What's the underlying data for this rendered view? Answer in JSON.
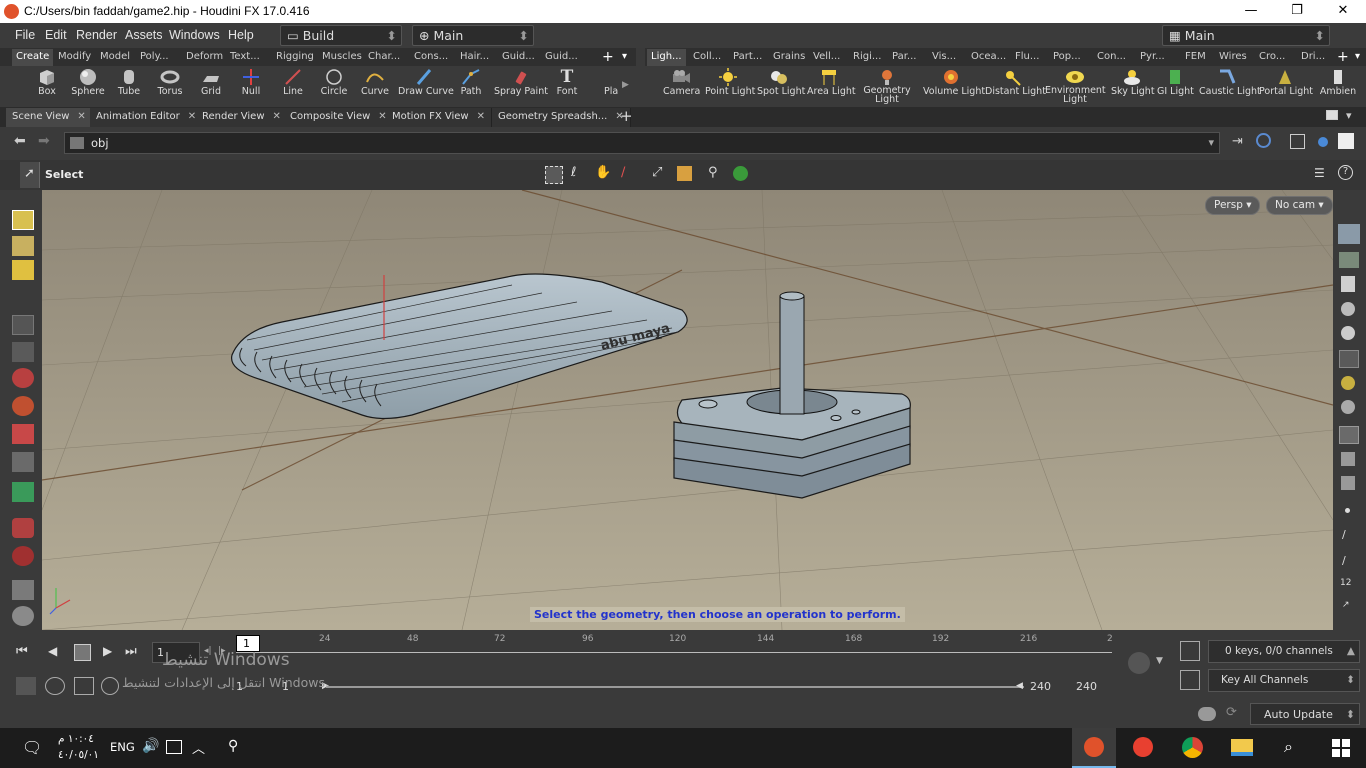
{
  "window": {
    "title": "C:/Users/bin faddah/game2.hip - Houdini FX 17.0.416",
    "minimize": "—",
    "restore": "❐",
    "close": "✕"
  },
  "menu": {
    "items": [
      "File",
      "Edit",
      "Render",
      "Assets",
      "Windows",
      "Help"
    ],
    "desktop_left": "Build",
    "desktop_mid": "Main",
    "desktop_right": "Main"
  },
  "shelf_left": {
    "tabs": [
      "Create",
      "Modify",
      "Model",
      "Poly...",
      "Deform",
      "Text...",
      "Rigging",
      "Muscles",
      "Char...",
      "Cons...",
      "Hair...",
      "Guid...",
      "Guid..."
    ],
    "tools": [
      "Box",
      "Sphere",
      "Tube",
      "Torus",
      "Grid",
      "Null",
      "Line",
      "Circle",
      "Curve",
      "Draw Curve",
      "Path",
      "Spray Paint",
      "Font",
      "Pla S"
    ]
  },
  "shelf_right": {
    "tabs": [
      "Ligh...",
      "Coll...",
      "Part...",
      "Grains",
      "Vell...",
      "Rigi...",
      "Par...",
      "Vis...",
      "Ocea...",
      "Flu...",
      "Pop...",
      "Con...",
      "Pyr...",
      "FEM",
      "Wires",
      "Cro...",
      "Dri..."
    ],
    "tools": [
      "Camera",
      "Point Light",
      "Spot Light",
      "Area Light",
      "Geometry Light",
      "Volume Light",
      "Distant Light",
      "Environment Light",
      "Sky Light",
      "GI Light",
      "Caustic Light",
      "Portal Light",
      "Ambien"
    ]
  },
  "pane_tabs": [
    "Scene View",
    "Animation Editor",
    "Render View",
    "Composite View",
    "Motion FX View",
    "Geometry Spreadsh..."
  ],
  "path": {
    "value": "obj"
  },
  "op_toolbar": {
    "label": "Select"
  },
  "viewport": {
    "persp": "Persp ▾",
    "cam": "No cam ▾",
    "message": "Select the geometry, then choose an operation to perform.",
    "model_text": "abu maya"
  },
  "timeline": {
    "current_frame": "1",
    "ticks": [
      "24",
      "48",
      "72",
      "96",
      "120",
      "144",
      "168",
      "192",
      "216",
      "2"
    ],
    "frame_marker": "1",
    "start": "1",
    "start2": "1",
    "end": "240",
    "end2": "240",
    "keys_info": "0 keys, 0/0 channels",
    "key_channels": "Key All Channels",
    "auto_update": "Auto Update",
    "watermark_line1": "تنشيط Windows",
    "watermark_line2": "انتقل إلى الإعدادات لتنشيط Windows."
  },
  "taskbar": {
    "time": "١٠:٠٤ م",
    "date": "٤٠/٠٥/٠١",
    "lang": "ENG"
  },
  "colors": {
    "viewport_bg": "#a79f8a",
    "houdini_orange": "#e0522b",
    "message_text": "#2233cc"
  }
}
